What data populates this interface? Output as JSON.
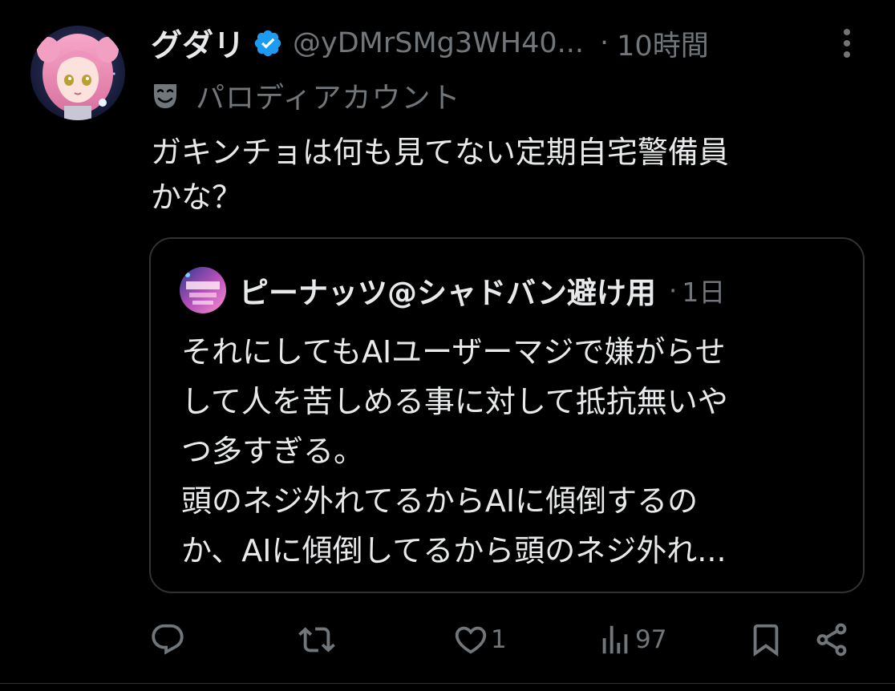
{
  "post": {
    "author": {
      "display_name": "グダリ",
      "handle": "@yDMrSMg3WH40...",
      "verified": true
    },
    "separator": "·",
    "timestamp": "10時間",
    "account_label": "パロディアカウント",
    "text": "ガキンチョは何も見てない定期自宅警備員\nかな？",
    "quote": {
      "author": "ピーナッツ@シャドバン避け用",
      "separator": "·",
      "timestamp": "1日",
      "text": "それにしてもAIユーザーマジで嫌がらせ\nして人を苦しめる事に対して抵抗無いや\nつ多すぎる。\n頭のネジ外れてるからAIに傾倒するの\nか、AIに傾倒してるから頭のネジ外れ..."
    },
    "actions": {
      "reply_count": "",
      "repost_count": "",
      "like_count": "1",
      "view_count": "97"
    }
  },
  "icons": {
    "verified": "verified-badge-icon",
    "more": "more-vertical-icon",
    "label": "drama-mask-icon",
    "reply": "reply-icon",
    "repost": "repost-icon",
    "like": "heart-icon",
    "views": "views-icon",
    "bookmark": "bookmark-icon",
    "share": "share-icon"
  },
  "colors": {
    "background": "#000000",
    "text_primary": "#e7e9ea",
    "text_secondary": "#71767b",
    "border": "#2f3336",
    "verified_blue": "#1d9bf0"
  }
}
